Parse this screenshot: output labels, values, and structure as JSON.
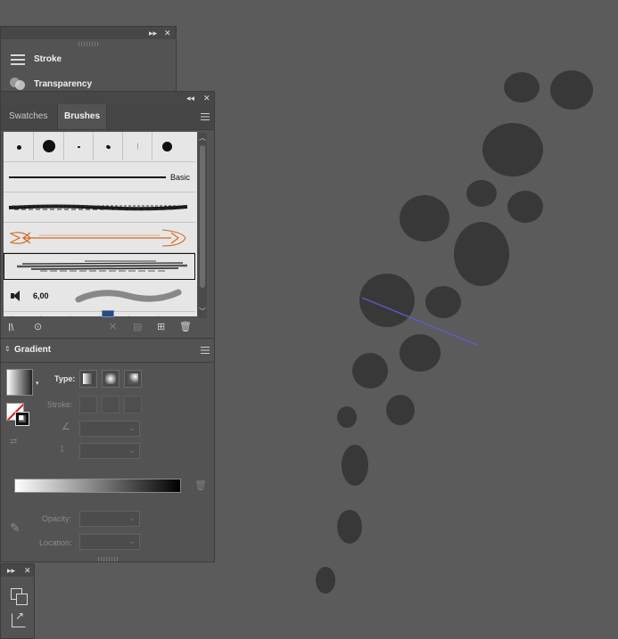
{
  "panels": {
    "stroke_transparency": {
      "items": [
        {
          "label": "Stroke",
          "icon": "stroke-lines-icon"
        },
        {
          "label": "Transparency",
          "icon": "transparency-circles-icon"
        }
      ]
    },
    "brushes": {
      "tabs": [
        {
          "label": "Swatches",
          "active": false
        },
        {
          "label": "Brushes",
          "active": true
        }
      ],
      "basic_label": "Basic",
      "size_value": "6,00"
    },
    "gradient": {
      "title": "Gradient",
      "type_label": "Type:",
      "stroke_label": "Stroke:",
      "opacity_label": "Opacity:",
      "location_label": "Location:"
    }
  },
  "colors": {
    "canvas": "#5b5b5b",
    "panel": "#535353",
    "blob": "#383838",
    "path_line": "#5c5cd6",
    "accent_brush": "#d2691e"
  }
}
